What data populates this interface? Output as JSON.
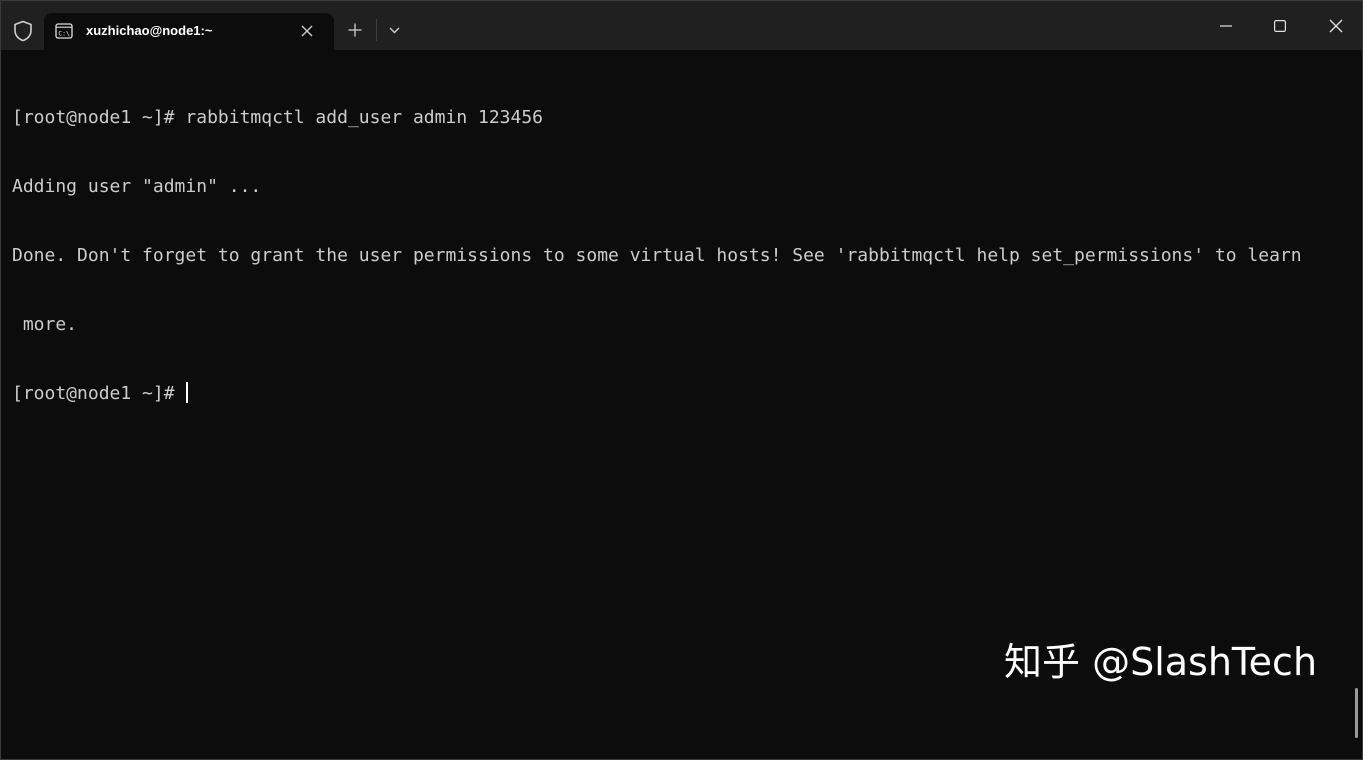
{
  "titlebar": {
    "tab_title": "xuzhichao@node1:~",
    "icons": [
      "shield-icon",
      "terminal-tab-icon",
      "close-icon",
      "plus-icon",
      "chevron-down-icon",
      "minimize-icon",
      "maximize-icon",
      "close-window-icon"
    ]
  },
  "terminal": {
    "lines": [
      "[root@node1 ~]# rabbitmqctl add_user admin 123456",
      "Adding user \"admin\" ...",
      "Done. Don't forget to grant the user permissions to some virtual hosts! See 'rabbitmqctl help set_permissions' to learn",
      " more.",
      "[root@node1 ~]# "
    ],
    "colors": {
      "background": "#0c0c0c",
      "foreground": "#cccccc",
      "titlebar": "#202020"
    }
  },
  "watermark": {
    "text": "知乎 @SlashTech"
  }
}
